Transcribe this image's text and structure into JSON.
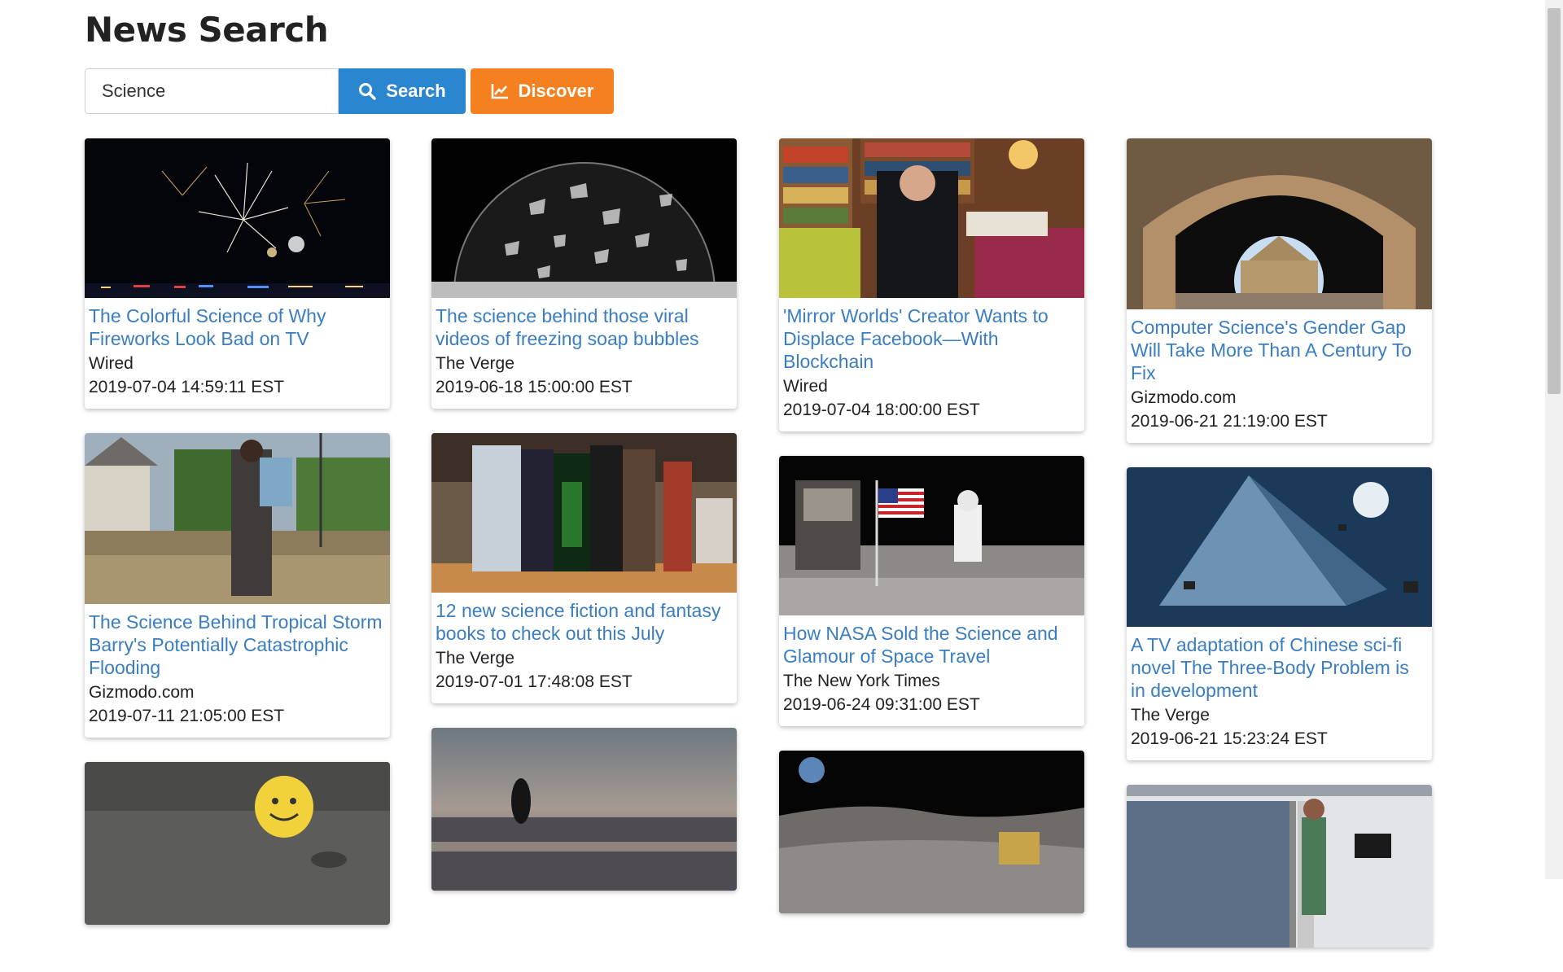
{
  "header": {
    "title": "News Search"
  },
  "search": {
    "value": "Science",
    "search_label": "Search",
    "discover_label": "Discover"
  },
  "colors": {
    "search_button": "#2b86d0",
    "discover_button": "#f58020",
    "link": "#3a7dc1"
  },
  "columns": [
    {
      "cards": [
        {
          "headline": "The Colorful Science of Why Fireworks Look Bad on TV",
          "source": "Wired",
          "date": "2019-07-04 14:59:11 EST"
        },
        {
          "headline": "The Science Behind Tropical Storm Barry's Potentially Catastrophic Flooding",
          "source": "Gizmodo.com",
          "date": "2019-07-11 21:05:00 EST"
        }
      ]
    },
    {
      "cards": [
        {
          "headline": "The science behind those viral videos of freezing soap bubbles",
          "source": "The Verge",
          "date": "2019-06-18 15:00:00 EST"
        },
        {
          "headline": "12 new science fiction and fantasy books to check out this July",
          "source": "The Verge",
          "date": "2019-07-01 17:48:08 EST"
        }
      ]
    },
    {
      "cards": [
        {
          "headline": "'Mirror Worlds' Creator Wants to Displace Facebook—With Blockchain",
          "source": "Wired",
          "date": "2019-07-04 18:00:00 EST"
        },
        {
          "headline": "How NASA Sold the Science and Glamour of Space Travel",
          "source": "The New York Times",
          "date": "2019-06-24 09:31:00 EST"
        }
      ]
    },
    {
      "cards": [
        {
          "headline": "Computer Science's Gender Gap Will Take More Than A Century To Fix",
          "source": "Gizmodo.com",
          "date": "2019-06-21 21:19:00 EST"
        },
        {
          "headline": "A TV adaptation of Chinese sci-fi novel The Three-Body Problem is in development",
          "source": "The Verge",
          "date": "2019-06-21 15:23:24 EST"
        }
      ]
    }
  ]
}
